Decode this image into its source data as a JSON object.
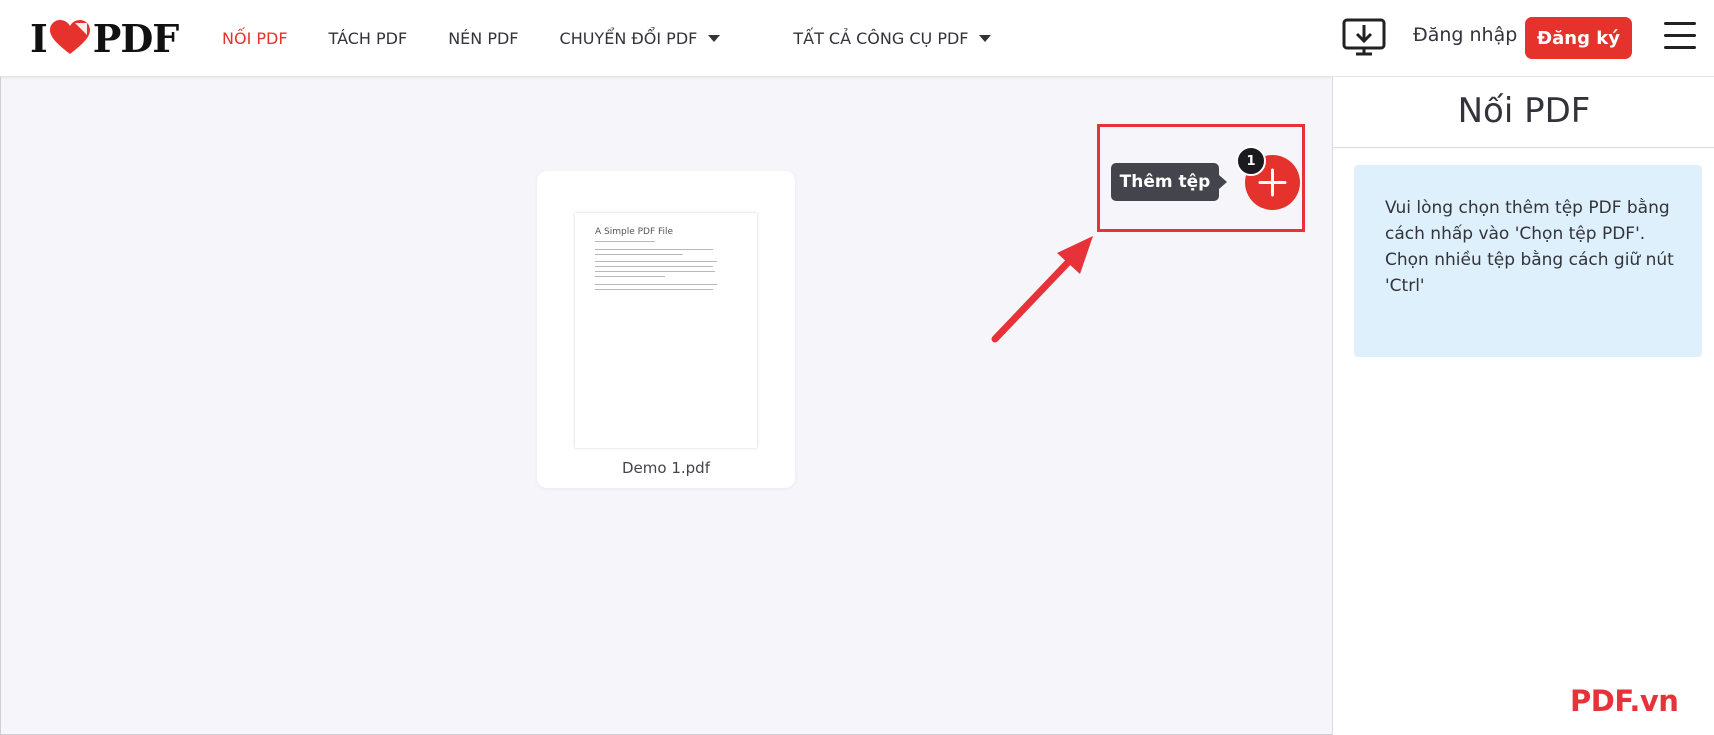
{
  "header": {
    "logo": {
      "left": "I",
      "right": "PDF",
      "icon": "heart-logo-icon",
      "brand_color": "#e5322d"
    },
    "nav": [
      {
        "label": "NỐI PDF",
        "active": true
      },
      {
        "label": "TÁCH PDF",
        "active": false
      },
      {
        "label": "NÉN PDF",
        "active": false
      },
      {
        "label": "CHUYỂN ĐỔI PDF",
        "active": false,
        "dropdown": true
      },
      {
        "label": "TẤT CẢ CÔNG CỤ PDF",
        "active": false,
        "dropdown": true
      }
    ],
    "desktop_icon": "desktop-download-icon",
    "login_label": "Đăng nhập",
    "signup_label": "Đăng ký",
    "menu_icon": "hamburger-menu-icon"
  },
  "workspace": {
    "files": [
      {
        "name": "Demo 1.pdf",
        "thumbnail_title": "A Simple PDF File"
      }
    ],
    "add_button": {
      "tooltip": "Thêm tệp",
      "badge_count": "1",
      "icon": "plus-icon"
    },
    "annotation_arrow_color": "#e8323a"
  },
  "sidebar": {
    "title": "Nối PDF",
    "info_line1": "Vui lòng chọn thêm tệp PDF bằng cách nhấp vào 'Chọn tệp PDF'.",
    "info_line2": "Chọn nhiều tệp bằng cách giữ nút 'Ctrl'"
  },
  "watermark": "PDF.vn",
  "colors": {
    "accent": "#e5322d",
    "info_bg": "#dff0fd",
    "canvas_bg": "#f5f5fa"
  }
}
